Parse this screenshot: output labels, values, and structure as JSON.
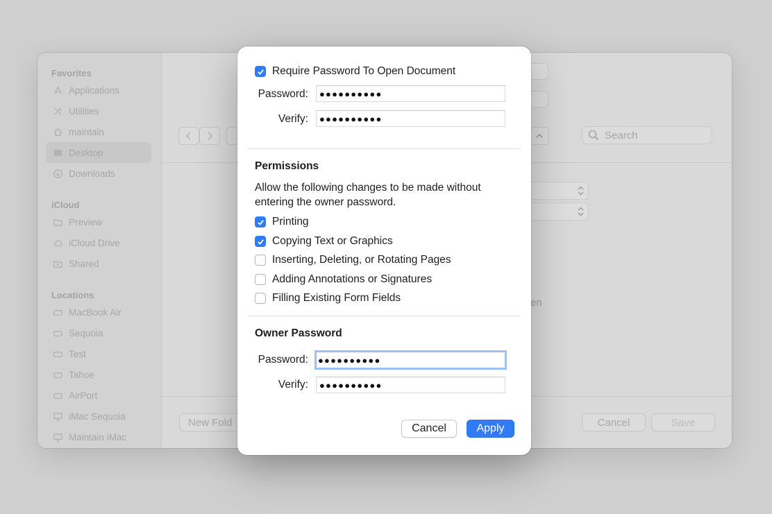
{
  "background": {
    "sidebar": {
      "sections": [
        {
          "title": "Favorites",
          "items": [
            {
              "label": "Applications",
              "icon": "applications-icon"
            },
            {
              "label": "Utilities",
              "icon": "utilities-icon"
            },
            {
              "label": "maintain",
              "icon": "home-icon"
            },
            {
              "label": "Desktop",
              "icon": "desktop-icon",
              "selected": true
            },
            {
              "label": "Downloads",
              "icon": "downloads-icon"
            }
          ]
        },
        {
          "title": "iCloud",
          "items": [
            {
              "label": "Preview",
              "icon": "folder-icon"
            },
            {
              "label": "iCloud Drive",
              "icon": "cloud-icon"
            },
            {
              "label": "Shared",
              "icon": "shared-folder-icon"
            }
          ]
        },
        {
          "title": "Locations",
          "items": [
            {
              "label": "MacBook Air",
              "icon": "drive-icon"
            },
            {
              "label": "Sequoia",
              "icon": "drive-icon"
            },
            {
              "label": "Test",
              "icon": "drive-icon"
            },
            {
              "label": "Tahoe",
              "icon": "drive-icon"
            },
            {
              "label": "AirPort",
              "icon": "drive-icon"
            },
            {
              "label": "iMac Sequoia",
              "icon": "display-icon"
            },
            {
              "label": "Maintain iMac",
              "icon": "display-icon"
            }
          ]
        }
      ]
    },
    "search_placeholder": "Search",
    "new_folder_label": "New Fold",
    "partial_text": "en",
    "cancel_label": "Cancel",
    "save_label": "Save"
  },
  "dialog": {
    "require_password": {
      "label": "Require Password To Open Document",
      "checked": true
    },
    "open_password": {
      "password_label": "Password:",
      "password_value": "●●●●●●●●●●",
      "verify_label": "Verify:",
      "verify_value": "●●●●●●●●●●"
    },
    "permissions": {
      "heading": "Permissions",
      "description": "Allow the following changes to be made without entering the owner password.",
      "options": [
        {
          "label": "Printing",
          "checked": true
        },
        {
          "label": "Copying Text or Graphics",
          "checked": true
        },
        {
          "label": "Inserting, Deleting, or Rotating Pages",
          "checked": false
        },
        {
          "label": "Adding Annotations or Signatures",
          "checked": false
        },
        {
          "label": "Filling Existing Form Fields",
          "checked": false
        }
      ]
    },
    "owner_password": {
      "heading": "Owner Password",
      "password_label": "Password:",
      "password_value": "●●●●●●●●●●",
      "verify_label": "Verify:",
      "verify_value": "●●●●●●●●●●"
    },
    "buttons": {
      "cancel": "Cancel",
      "apply": "Apply"
    }
  },
  "colors": {
    "accent": "#2f7cf6",
    "focus_ring": "#9fc0f5"
  }
}
